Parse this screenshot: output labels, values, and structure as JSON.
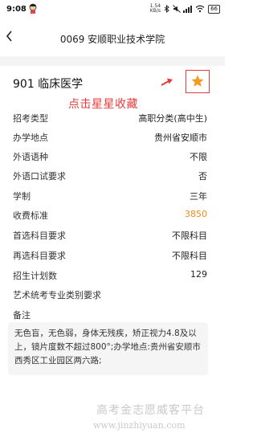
{
  "status_bar": {
    "time": "9:08",
    "net_speed_value": "1.54",
    "net_speed_unit": "KB/s",
    "battery": "66"
  },
  "nav": {
    "title": "0069 安顺职业技术学院"
  },
  "major": {
    "title": "901 临床医学",
    "annotation": "点击星星收藏",
    "star_color": "#f39a1f",
    "highlight_color": "#e53b3b"
  },
  "fields": [
    {
      "label": "招考类型",
      "value": "高职分类(高中生)"
    },
    {
      "label": "办学地点",
      "value": "贵州省安顺市"
    },
    {
      "label": "外语语种",
      "value": "不限"
    },
    {
      "label": "外语口试要求",
      "value": "否"
    },
    {
      "label": "学制",
      "value": "三年"
    },
    {
      "label": "收费标准",
      "value": "3850"
    },
    {
      "label": "首选科目要求",
      "value": "不限科目"
    },
    {
      "label": "再选科目要求",
      "value": "不限科目"
    },
    {
      "label": "招生计划数",
      "value": "129"
    },
    {
      "label": "艺术统考专业类别要求",
      "value": ""
    },
    {
      "label": "备注",
      "value": ""
    }
  ],
  "notes": {
    "line1": "无色盲，无色弱，身体无残疾，矫正视力4.8及以",
    "line2": "上，镜片度数不超过800°;办学地点:贵州省安顺市",
    "line3": "西秀区工业园区两六路;"
  },
  "watermark": {
    "name": "高考金志愿威客平台",
    "url": "www.jinzhiyuan.com"
  }
}
